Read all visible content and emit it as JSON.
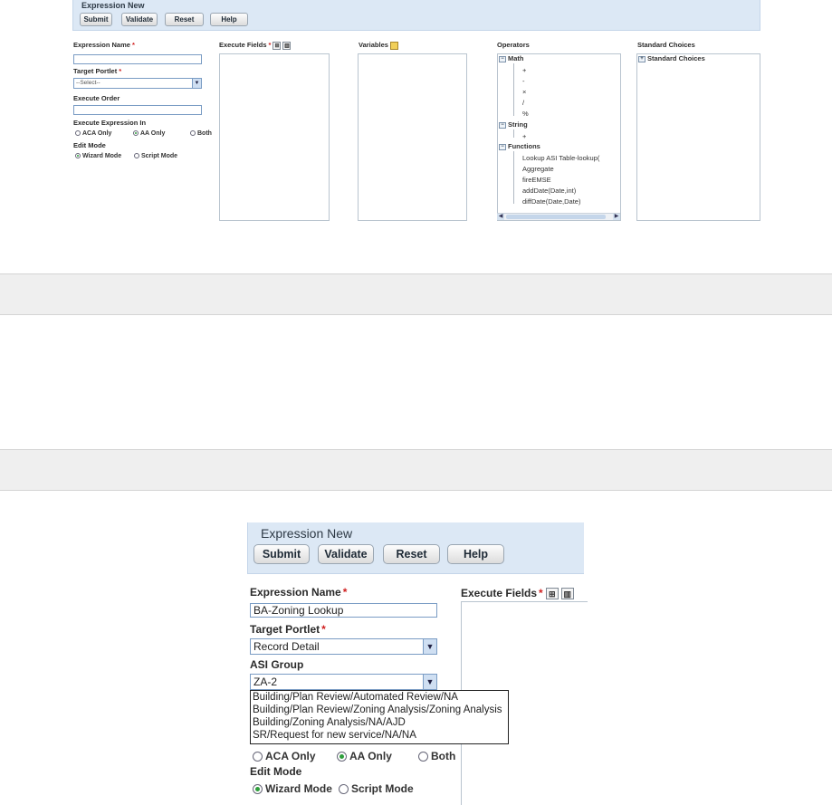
{
  "panel_small": {
    "title": "Expression New",
    "buttons": {
      "submit": "Submit",
      "validate": "Validate",
      "reset": "Reset",
      "help": "Help"
    },
    "expression_name_label": "Expression Name",
    "target_portlet_label": "Target Portlet",
    "target_portlet_value": "--Select--",
    "execute_order_label": "Execute Order",
    "execute_expression_in_label": "Execute Expression In",
    "radio_aca": "ACA Only",
    "radio_aa": "AA Only",
    "radio_both": "Both",
    "edit_mode_label": "Edit Mode",
    "radio_wizard": "Wizard Mode",
    "radio_script": "Script Mode",
    "execute_fields_label": "Execute Fields",
    "variables_label": "Variables",
    "operators_label": "Operators",
    "standard_choices_label": "Standard Choices",
    "required_mark": "*",
    "operators_tree": {
      "math": "Math",
      "math_items": [
        "+",
        "-",
        "×",
        "/",
        "%"
      ],
      "string": "String",
      "string_items": [
        "+"
      ],
      "functions": "Functions",
      "function_items": [
        "Lookup ASI Table-lookup(",
        "Aggregate",
        "fireEMSE",
        "addDate(Date,int)",
        "diffDate(Date,Date)"
      ]
    },
    "standard_choices_root": "Standard Choices"
  },
  "panel_zoom": {
    "title": "Expression New",
    "buttons": {
      "submit": "Submit",
      "validate": "Validate",
      "reset": "Reset",
      "help": "Help"
    },
    "expression_name_label": "Expression Name",
    "expression_name_value": "BA-Zoning Lookup",
    "target_portlet_label": "Target Portlet",
    "target_portlet_value": "Record Detail",
    "asi_group_label": "ASI Group",
    "asi_group_value": "ZA-2",
    "asi_group_options": [
      "Building/Plan Review/Automated Review/NA",
      "Building/Plan Review/Zoning Analysis/Zoning Analysis",
      "Building/Zoning Analysis/NA/AJD",
      "SR/Request for new service/NA/NA"
    ],
    "radio_aca": "ACA Only",
    "radio_aa": "AA Only",
    "radio_both": "Both",
    "edit_mode_label": "Edit Mode",
    "radio_wizard": "Wizard Mode",
    "radio_script": "Script Mode",
    "execute_fields_label": "Execute Fields",
    "required_mark": "*"
  },
  "colors": {
    "header_bg": "#dce8f5",
    "required": "#d02020",
    "radio_selected": "#2e9e3c",
    "input_border": "#7a9cc4"
  }
}
